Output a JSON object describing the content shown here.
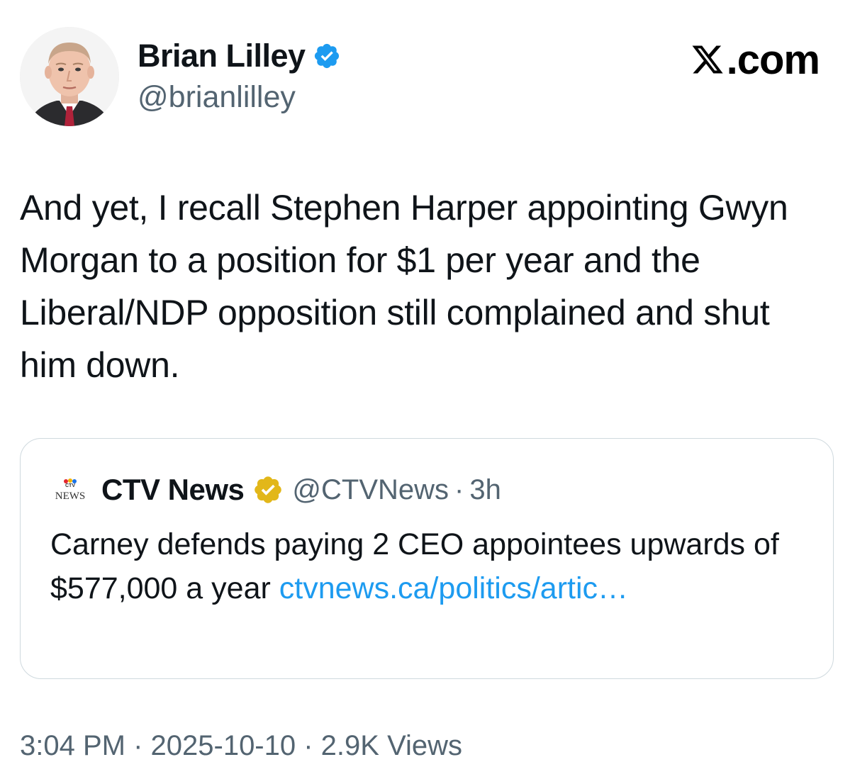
{
  "author": {
    "name": "Brian Lilley",
    "handle": "@brianlilley",
    "verified_icon": "verified-badge-blue-icon",
    "avatar_icon": "profile-avatar"
  },
  "brand": {
    "icon": "x-logo-icon",
    "text": ".com"
  },
  "tweet": {
    "text": "And yet, I recall Stephen Harper appointing Gwyn Morgan to a position for $1 per year and the Liberal/NDP opposition still complained and shut him down."
  },
  "quote": {
    "logo_icon": "ctv-news-logo",
    "name": "CTV News",
    "verified_icon": "verified-badge-gold-icon",
    "handle": "@CTVNews",
    "separator": "·",
    "time": "3h",
    "text": "Carney defends paying 2 CEO appointees upwards of $577,000 a year ",
    "link": "ctvnews.ca/politics/artic…"
  },
  "footer": {
    "meta": "3:04 PM · 2025-10-10 · 2.9K Views"
  },
  "colors": {
    "text_primary": "#0f1419",
    "text_secondary": "#536471",
    "link": "#1d9bf0",
    "verified_blue": "#1d9bf0",
    "verified_gold": "#e2b719",
    "border": "#cfd9de"
  }
}
